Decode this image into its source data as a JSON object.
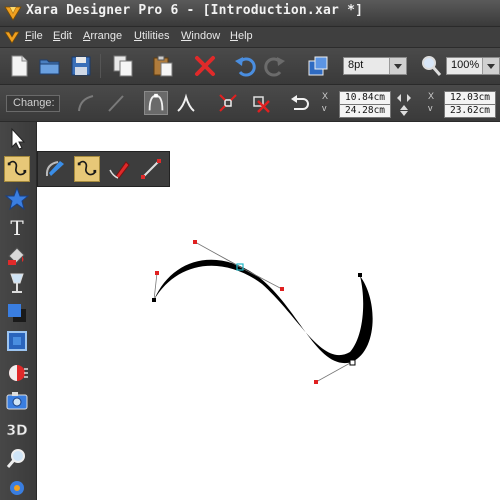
{
  "window": {
    "title": "Xara Designer Pro 6 - [Introduction.xar *]"
  },
  "menu": {
    "items": [
      {
        "ul": "F",
        "rest": "ile"
      },
      {
        "ul": "E",
        "rest": "dit"
      },
      {
        "ul": "A",
        "rest": "rrange"
      },
      {
        "ul": "U",
        "rest": "tilities"
      },
      {
        "ul": "W",
        "rest": "indow"
      },
      {
        "ul": "H",
        "rest": "elp"
      }
    ]
  },
  "toolbar": {
    "line_width": "8pt",
    "zoom": "100%"
  },
  "infobar": {
    "change_label": "Change:",
    "x_coords": [
      "10.84cm",
      "24.28cm"
    ],
    "y_coords": [
      "12.03cm",
      "23.62cm"
    ]
  },
  "icons": {
    "left_tools": [
      "selector-icon",
      "shape-editor-icon",
      "quickshape-icon",
      "text-icon",
      "fill-icon",
      "transparency-icon",
      "shadow-icon",
      "bevel-icon",
      "mould-icon",
      "photo-icon",
      "3d-extrude-icon",
      "zoom-icon",
      "live-effects-icon"
    ],
    "flyout": [
      "contour-icon",
      "shape-editor-icon",
      "freehand-icon",
      "straight-line-icon"
    ]
  },
  "colors": {
    "accent": "#e7c878",
    "canvas": "#ffffff",
    "chrome": "#3c3c3c",
    "handle_red": "#e02020",
    "handle_cyan": "#20b8c8"
  }
}
